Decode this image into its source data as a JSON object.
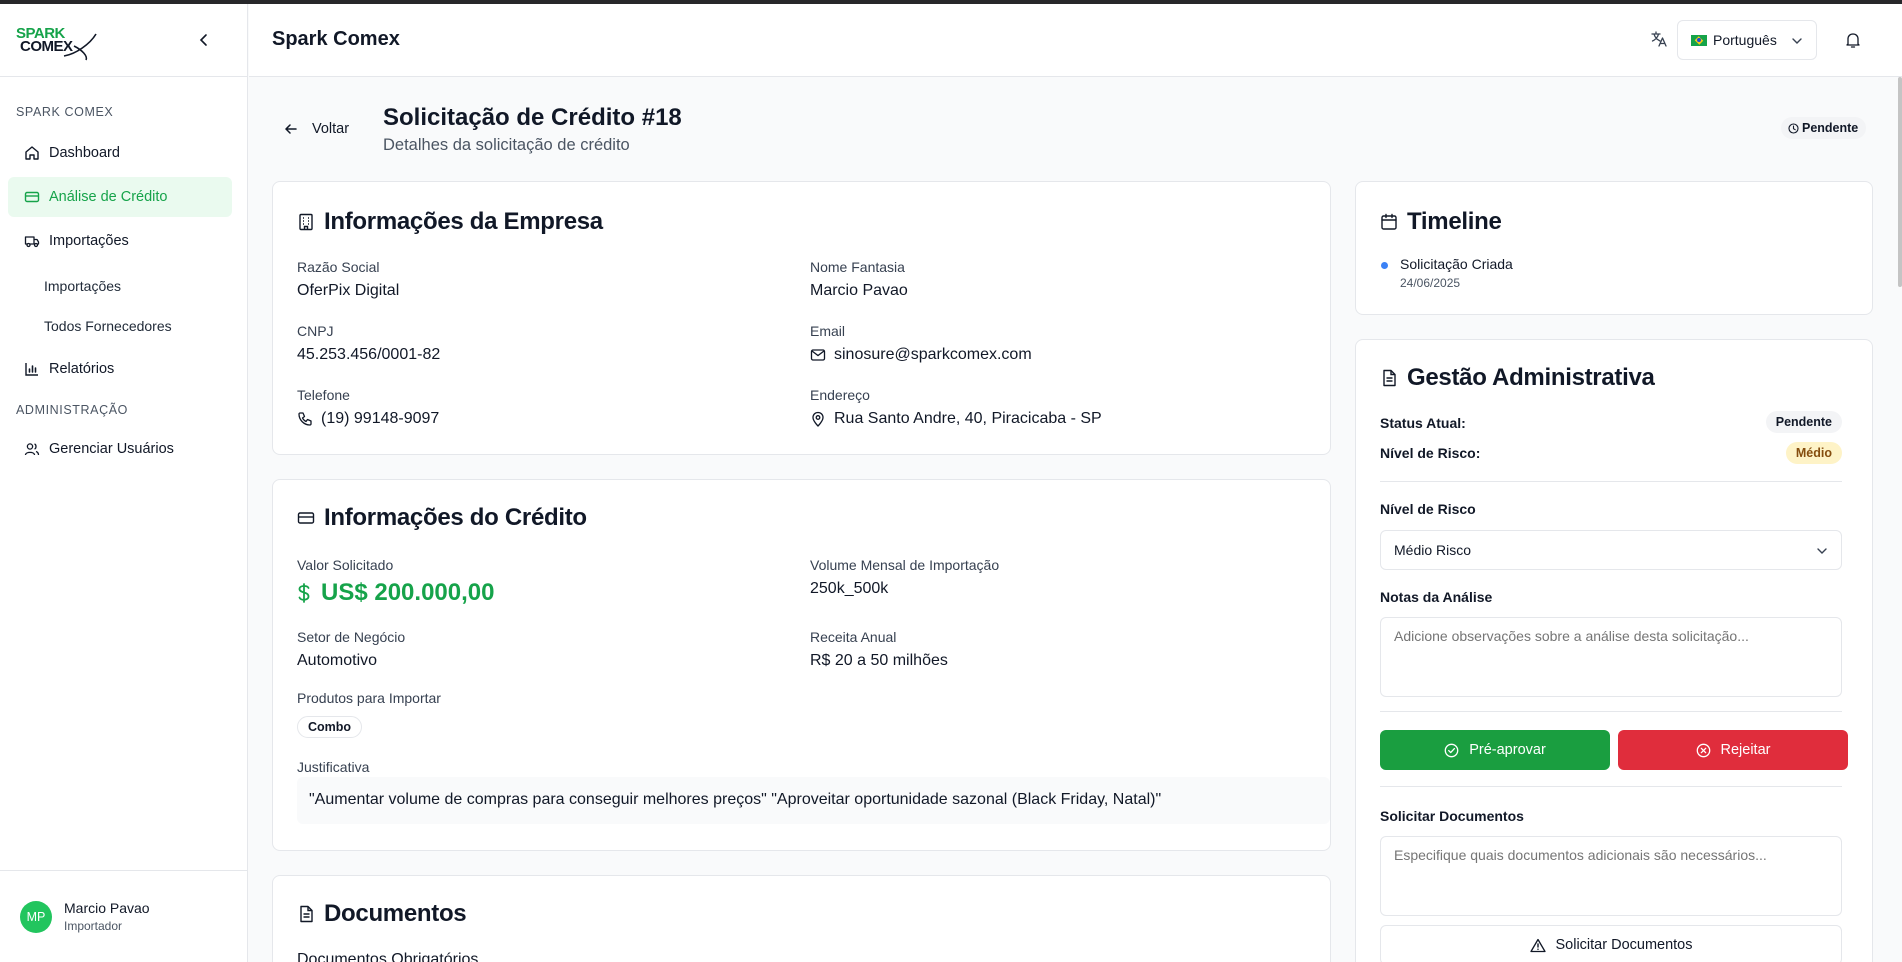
{
  "app": {
    "title": "Spark Comex"
  },
  "logo": {
    "line1": "SPARK",
    "line2": "COMEX"
  },
  "sidebar": {
    "section_main": "SPARK COMEX",
    "section_admin": "ADMINISTRAÇÃO",
    "items": [
      {
        "label": "Dashboard",
        "icon": "home-icon"
      },
      {
        "label": "Análise de Crédito",
        "icon": "credit-card-icon",
        "active": true
      },
      {
        "label": "Importações",
        "icon": "truck-icon"
      },
      {
        "label": "Relatórios",
        "icon": "bar-chart-icon"
      },
      {
        "label": "Gerenciar Usuários",
        "icon": "users-icon"
      }
    ],
    "subitems": [
      "Importações",
      "Todos Fornecedores"
    ],
    "user": {
      "initials": "MP",
      "name": "Marcio Pavao",
      "role": "Importador"
    }
  },
  "header": {
    "language": "Português"
  },
  "page": {
    "back_label": "Voltar",
    "title": "Solicitação de Crédito #18",
    "subtitle": "Detalhes da solicitação de crédito",
    "status": "Pendente"
  },
  "company": {
    "title": "Informações da Empresa",
    "fields": {
      "razao_label": "Razão Social",
      "razao_value": "OferPix Digital",
      "fantasia_label": "Nome Fantasia",
      "fantasia_value": "Marcio Pavao",
      "cnpj_label": "CNPJ",
      "cnpj_value": "45.253.456/0001-82",
      "email_label": "Email",
      "email_value": "sinosure@sparkcomex.com",
      "telefone_label": "Telefone",
      "telefone_value": "(19) 99148-9097",
      "endereco_label": "Endereço",
      "endereco_value": "Rua Santo Andre, 40, Piracicaba - SP"
    }
  },
  "credit": {
    "title": "Informações do Crédito",
    "valor_label": "Valor Solicitado",
    "valor_value": "US$ 200.000,00",
    "volume_label": "Volume Mensal de Importação",
    "volume_value": "250k_500k",
    "setor_label": "Setor de Negócio",
    "setor_value": "Automotivo",
    "receita_label": "Receita Anual",
    "receita_value": "R$ 20 a 50 milhões",
    "produtos_label": "Produtos para Importar",
    "produtos": [
      "Combo"
    ],
    "justificativa_label": "Justificativa",
    "justificativa_value": "\"Aumentar volume de compras para conseguir melhores preços\" \"Aproveitar oportunidade sazonal (Black Friday, Natal)\""
  },
  "documents": {
    "title": "Documentos",
    "subtitle": "Documentos Obrigatórios"
  },
  "timeline": {
    "title": "Timeline",
    "events": [
      {
        "label": "Solicitação Criada",
        "date": "24/06/2025"
      }
    ]
  },
  "admin": {
    "title": "Gestão Administrativa",
    "status_label": "Status Atual:",
    "status_value": "Pendente",
    "risk_label": "Nível de Risco:",
    "risk_value": "Médio",
    "risk_select_label": "Nível de Risco",
    "risk_select_value": "Médio Risco",
    "notes_label": "Notas da Análise",
    "notes_placeholder": "Adicione observações sobre a análise desta solicitação...",
    "approve_label": "Pré-aprovar",
    "reject_label": "Rejeitar",
    "docs_label": "Solicitar Documentos",
    "docs_placeholder": "Especifique quais documentos adicionais são necessários...",
    "docs_button": "Solicitar Documentos"
  },
  "colors": {
    "brand": "#16a34a",
    "approve": "#1a9e40",
    "reject": "#e02d3c",
    "timeline_dot": "#3b82f6"
  }
}
